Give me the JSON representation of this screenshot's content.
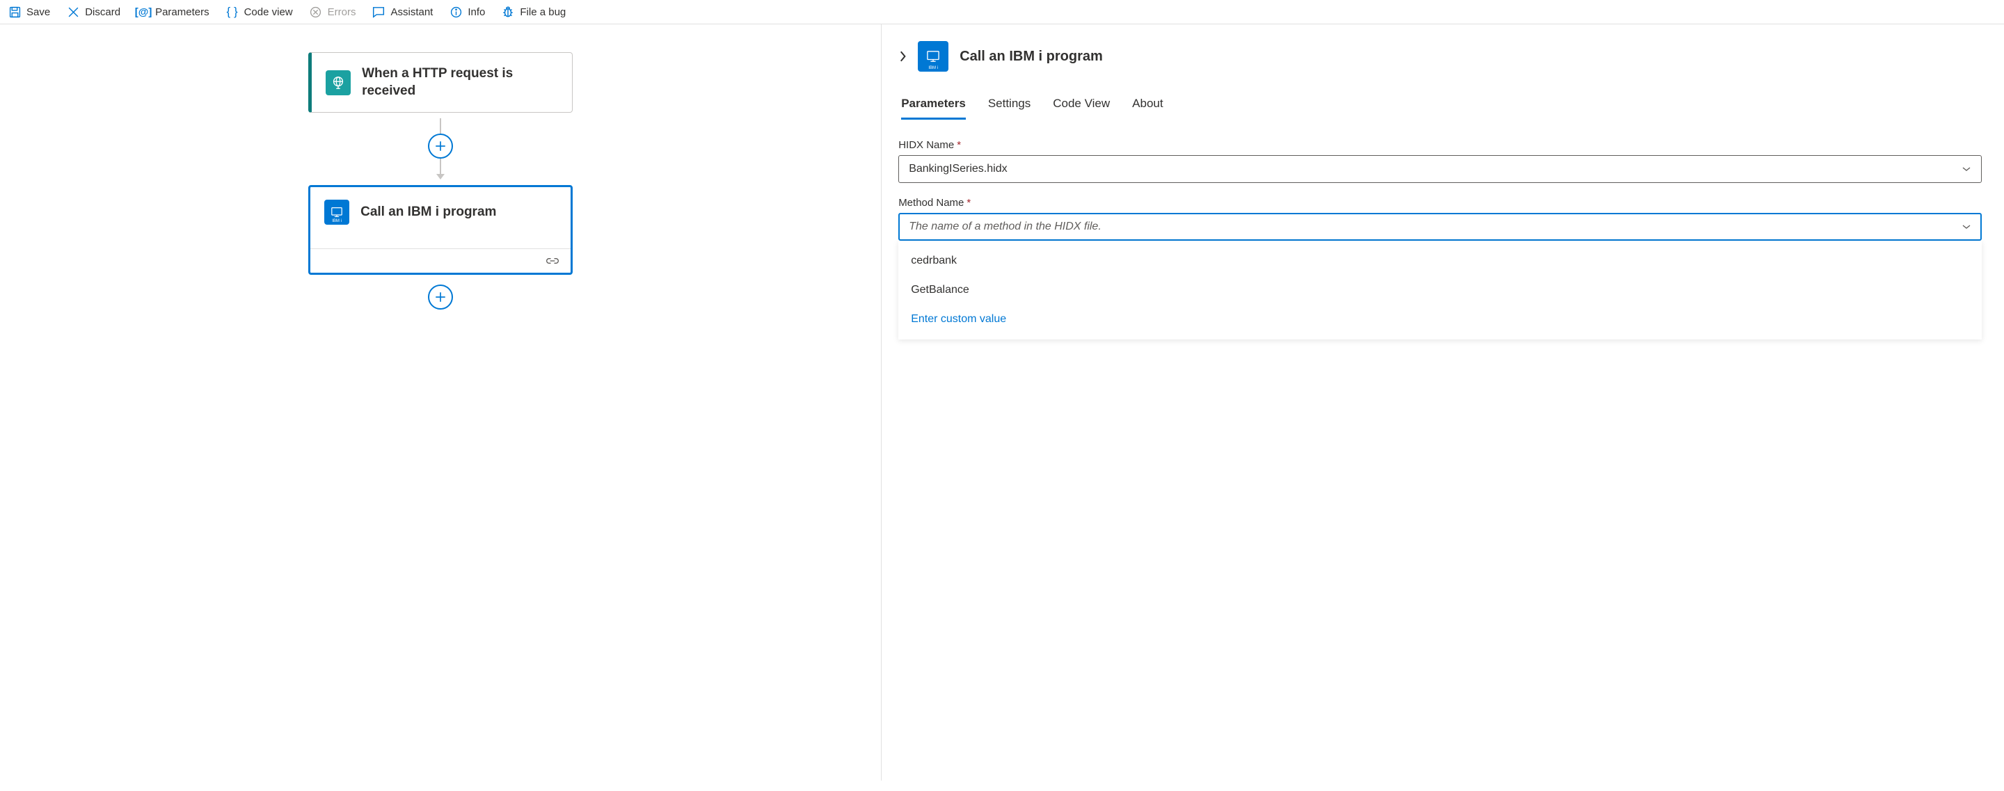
{
  "toolbar": {
    "save": "Save",
    "discard": "Discard",
    "parameters": "Parameters",
    "code_view": "Code view",
    "errors": "Errors",
    "assistant": "Assistant",
    "info": "Info",
    "file_bug": "File a bug"
  },
  "flow": {
    "trigger": {
      "title": "When a HTTP request is received"
    },
    "action": {
      "title": "Call an IBM i program",
      "icon_label": "IBM i"
    }
  },
  "panel": {
    "title": "Call an IBM i program",
    "icon_label": "IBM i",
    "tabs": {
      "parameters": "Parameters",
      "settings": "Settings",
      "code_view": "Code View",
      "about": "About"
    },
    "fields": {
      "hidx_name": {
        "label": "HIDX Name",
        "value": "BankingISeries.hidx"
      },
      "method_name": {
        "label": "Method Name",
        "placeholder": "The name of a method in the HIDX file.",
        "options": [
          "cedrbank",
          "GetBalance"
        ],
        "custom_label": "Enter custom value"
      }
    }
  }
}
